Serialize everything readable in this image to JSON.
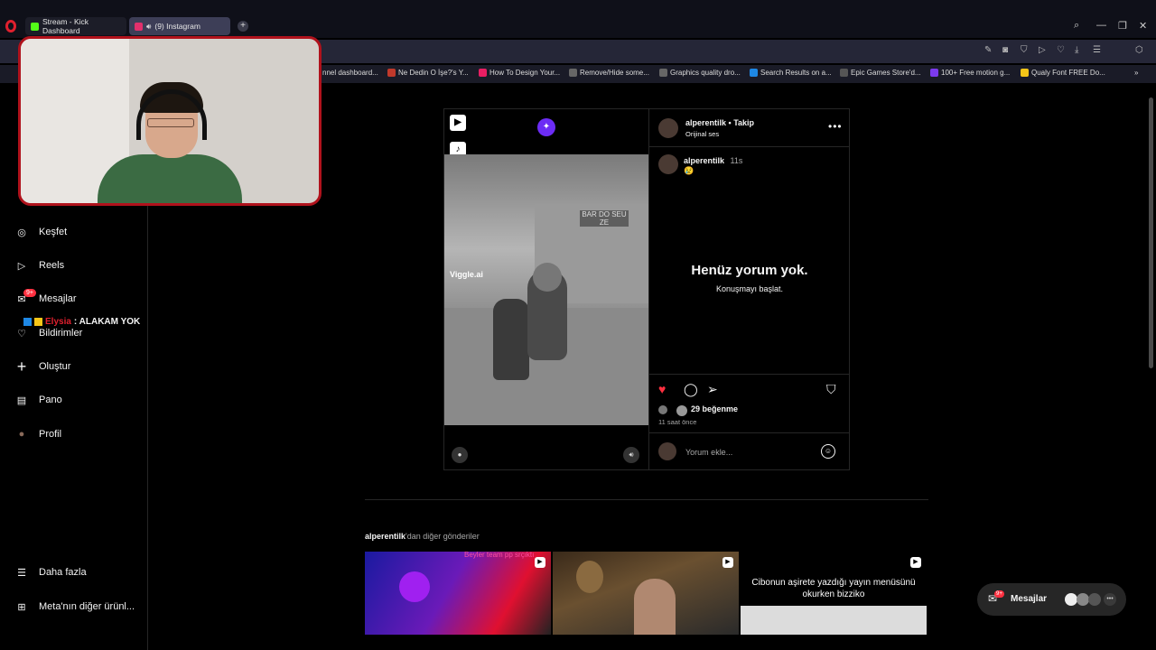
{
  "browser": {
    "tabs": [
      {
        "label": "Stream - Kick Dashboard",
        "favicon_color": "#53fc18"
      },
      {
        "label": "(9) Instagram",
        "favicon_color": "#e1306c"
      }
    ],
    "new_tab": "+",
    "bookmarks": [
      "nnel dashboard...",
      "Ne Dedin O İşe?'s Y...",
      "How To Design Your...",
      "Remove/Hide some...",
      "Graphics quality dro...",
      "Search Results on a...",
      "Epic Games Store'd...",
      "100+ Free motion g...",
      "Qualy Font FREE Do..."
    ]
  },
  "sidebar": {
    "items": [
      {
        "label": "Keşfet",
        "icon": "compass-icon",
        "glyph": "◎"
      },
      {
        "label": "Reels",
        "icon": "reels-icon",
        "glyph": "▷"
      },
      {
        "label": "Mesajlar",
        "icon": "messenger-icon",
        "glyph": "✉"
      },
      {
        "label": "Bildirimler",
        "icon": "heart-icon",
        "glyph": "♡"
      },
      {
        "label": "Oluştur",
        "icon": "plus-icon",
        "glyph": "+"
      },
      {
        "label": "Pano",
        "icon": "dashboard-icon",
        "glyph": "▤"
      },
      {
        "label": "Profil",
        "icon": "avatar",
        "glyph": "●"
      },
      {
        "label": "Daha fazla",
        "icon": "menu-icon",
        "glyph": "☰"
      },
      {
        "label": "Meta'nın diğer ürünl...",
        "icon": "meta-apps-icon",
        "glyph": "⊞"
      }
    ],
    "messages_badge": "9+"
  },
  "stream_overlay": {
    "chat_user": "Elysia",
    "chat_message": ": ALAKAM YOK"
  },
  "post": {
    "username": "alperentilk",
    "follow_label": "Takip",
    "audio": "Orijinal ses",
    "caption_user": "alperentilk",
    "caption_time": "11s",
    "caption_emoji": "😢",
    "watermark": "Viggle.ai",
    "sign_text": "BAR DO SEU ZE",
    "no_comments_title": "Henüz yorum yok.",
    "no_comments_sub": "Konuşmayı başlat.",
    "likes": "29 beğenme",
    "posted": "11 saat önce",
    "comment_placeholder": "Yorum ekle...",
    "liked": true,
    "like_color": "#ff3040"
  },
  "more_posts": {
    "title_user": "alperentilk",
    "title_rest": "'dan diğer gönderiler",
    "thumbs": [
      {
        "caption": "Beyler team pp srçıktı"
      },
      {
        "caption": ""
      },
      {
        "caption": "Cibonun aşirete yazdığı yayın menüsünü okurken bizziko"
      }
    ]
  },
  "messages_pill": {
    "label": "Mesajlar",
    "badge": "9+"
  }
}
